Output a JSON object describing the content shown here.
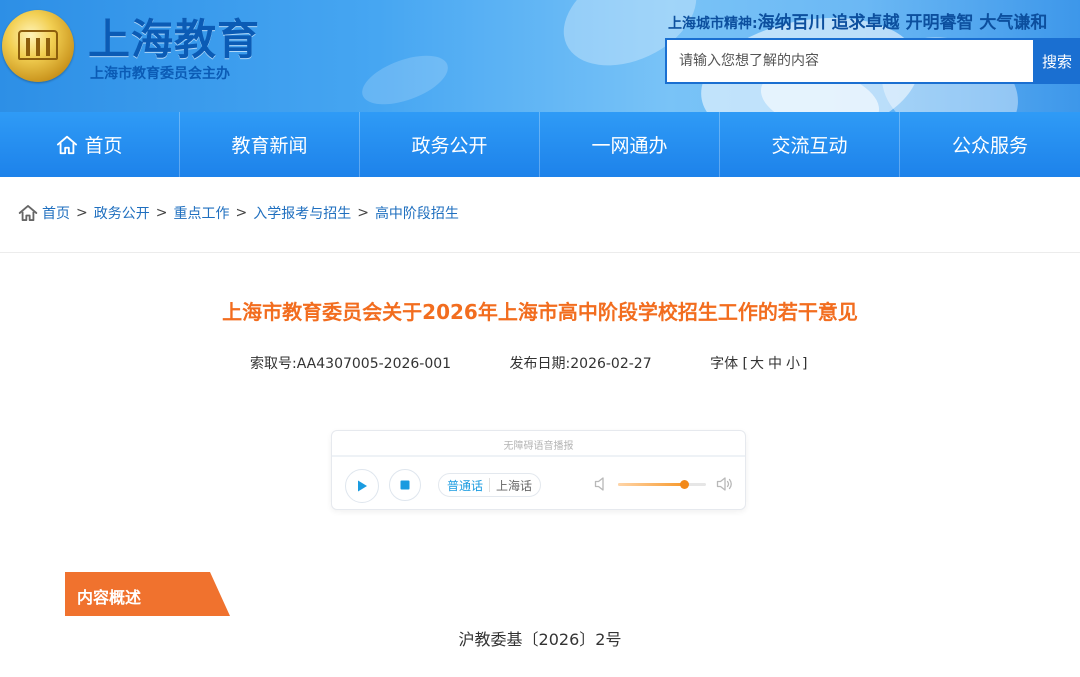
{
  "header": {
    "site_title": "上海教育",
    "site_subtitle": "上海市教育委员会主办",
    "spirit_label": "上海城市精神:",
    "spirit_text": "海纳百川 追求卓越 开明睿智 大气谦和",
    "emblem_icon": "shanghai-education-emblem",
    "search": {
      "placeholder": "请输入您想了解的内容",
      "button_label": "搜索"
    }
  },
  "nav": {
    "items": [
      {
        "label": "首页",
        "icon": "home-icon"
      },
      {
        "label": "教育新闻"
      },
      {
        "label": "政务公开"
      },
      {
        "label": "一网通办"
      },
      {
        "label": "交流互动"
      },
      {
        "label": "公众服务"
      }
    ]
  },
  "breadcrumb": {
    "icon": "home-icon",
    "separator": ">",
    "items": [
      "首页",
      "政务公开",
      "重点工作",
      "入学报考与招生",
      "高中阶段招生"
    ]
  },
  "article": {
    "title": "上海市教育委员会关于2026年上海市高中阶段学校招生工作的若干意见",
    "meta": {
      "index_label": "索取号:",
      "index_value": "AA4307005-2026-001",
      "date_label": "发布日期:",
      "date_value": "2026-02-27",
      "font_label": "字体",
      "font_open": "[",
      "font_large": "大",
      "font_medium": "中",
      "font_small": "小",
      "font_close": "]"
    },
    "section_title": "内容概述",
    "doc_number": "沪教委基〔2026〕2号"
  },
  "player": {
    "title": "无障碍语音播报",
    "lang_mandarin": "普通话",
    "lang_shanghainese": "上海话",
    "active_lang": "普通话",
    "volume": 0.75
  },
  "colors": {
    "brand_blue": "#1a6fd1",
    "nav_blue": "#1d82ea",
    "title_orange": "#f26d1f",
    "section_orange": "#f0722e",
    "link_blue": "#1f6fbf"
  }
}
